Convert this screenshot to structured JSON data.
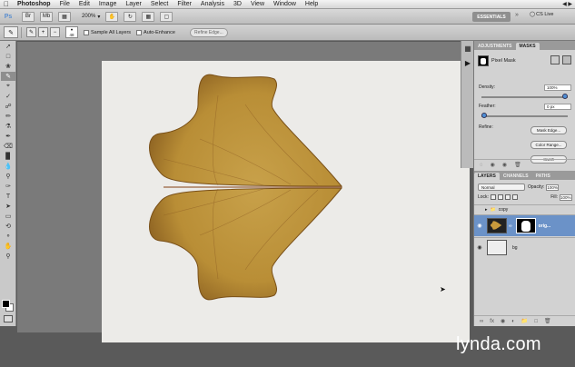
{
  "menubar": {
    "apple": "",
    "app": "Photoshop",
    "items": [
      "File",
      "Edit",
      "Image",
      "Layer",
      "Select",
      "Filter",
      "Analysis",
      "3D",
      "View",
      "Window",
      "Help"
    ],
    "right": "◀ ▶"
  },
  "appbar": {
    "logo": "Ps",
    "zoom": "200%",
    "essentials": "ESSENTIALS",
    "more": "»",
    "cslive": "CS Live"
  },
  "options": {
    "brush_size": "48",
    "sample_all_layers": "Sample All Layers",
    "auto_enhance": "Auto-Enhance",
    "refine_edge": "Refine Edge..."
  },
  "masks_panel": {
    "tabs": [
      "ADJUSTMENTS",
      "MASKS"
    ],
    "mask_type": "Pixel Mask",
    "density_label": "Density:",
    "density_value": "100%",
    "density_fraction": 1.0,
    "feather_label": "Feather:",
    "feather_value": "0 px",
    "feather_fraction": 0.0,
    "refine_label": "Refine:",
    "mask_edge": "Mask Edge...",
    "color_range": "Color Range...",
    "invert": "Invert"
  },
  "layers_panel": {
    "tabs": [
      "LAYERS",
      "CHANNELS",
      "PATHS"
    ],
    "blend_mode": "Normal",
    "opacity_label": "Opacity:",
    "opacity_value": "100%",
    "lock_label": "Lock:",
    "fill_label": "Fill:",
    "fill_value": "100%",
    "layers": [
      {
        "name": "copy",
        "type": "group"
      },
      {
        "name": "orig...",
        "type": "layer",
        "selected": true
      },
      {
        "name": "bg",
        "type": "layer"
      }
    ]
  },
  "watermark": "lynda.com",
  "colors": {
    "leaf_main": "#c89a3c",
    "leaf_edge": "#8a5a1c",
    "selection_blue": "#6b92c8",
    "slider_knob": "#4e8fd6"
  }
}
